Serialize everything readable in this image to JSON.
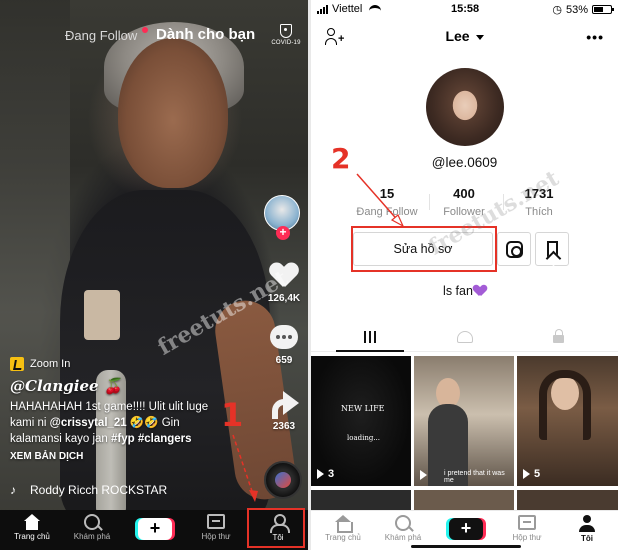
{
  "feed": {
    "tabs": {
      "following": "Đang Follow",
      "for_you": "Dành cho bạn"
    },
    "covid_label": "COVID-19",
    "likes": "126,4K",
    "comments": "659",
    "shares": "2363",
    "effect": "Zoom In",
    "username": "@Clangiee 🍒",
    "caption_line1": "HAHAHAHAH 1st game!!!! Ulit ulit luge",
    "caption_line2_pre": "kami ni ",
    "caption_mention": "@crissytal_21",
    "caption_line2_post": " 🤣🤣 Gin",
    "caption_line3_pre": "kalamansi kayo jan ",
    "caption_tags": "#fyp #clangers",
    "translate": "XEM BẢN DỊCH",
    "sound": "Roddy Ricch    ROCKSTAR",
    "tabbar": {
      "home": "Trang chủ",
      "discover": "Khám phá",
      "inbox": "Hộp thư",
      "me": "Tôi"
    }
  },
  "profile": {
    "status": {
      "carrier": "Viettel",
      "time": "15:58",
      "battery": "53%"
    },
    "name": "Lee",
    "handle": "@lee.0609",
    "stats": [
      {
        "num": "15",
        "label": "Đang Follow"
      },
      {
        "num": "400",
        "label": "Follower"
      },
      {
        "num": "1731",
        "label": "Thích"
      }
    ],
    "edit_button": "Sửa hồ sơ",
    "bio": "ls fan",
    "videos": [
      {
        "views": "3",
        "text": "NEW LIFE",
        "subtext": "loading..."
      },
      {
        "views": "",
        "text": "i pretend that it was me"
      },
      {
        "views": "5"
      }
    ],
    "tabbar": {
      "home": "Trang chủ",
      "discover": "Khám phá",
      "inbox": "Hộp thư",
      "me": "Tôi"
    }
  },
  "annotations": {
    "step1": "1",
    "step2": "2",
    "watermark": "freetuts.net"
  },
  "colors": {
    "accent_red": "#fe2c55",
    "annotation_red": "#e53227",
    "cyan": "#25f4ee",
    "bio_heart": "#a35cd6"
  },
  "icons": [
    "shield-icon",
    "heart-icon",
    "comment-icon",
    "share-icon",
    "music-disc-icon",
    "note-icon",
    "home-icon",
    "search-icon",
    "plus-icon",
    "inbox-icon",
    "person-icon",
    "add-friend-icon",
    "more-icon",
    "instagram-icon",
    "bookmark-icon",
    "grid-icon",
    "liked-icon",
    "lock-icon",
    "play-icon",
    "purple-heart-icon"
  ]
}
